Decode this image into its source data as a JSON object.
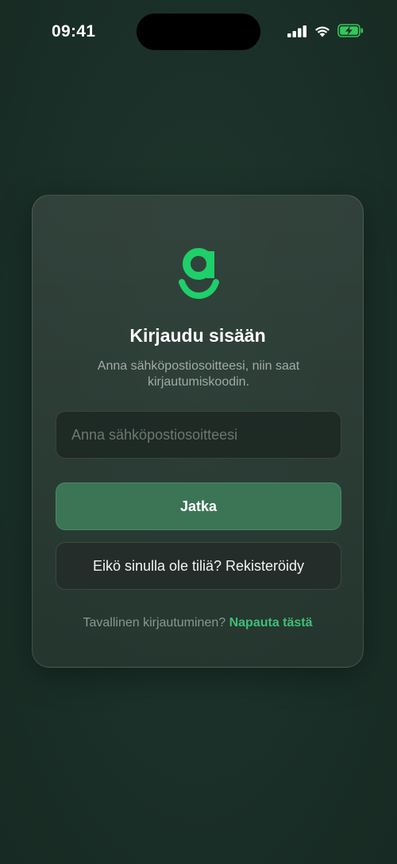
{
  "status_bar": {
    "time": "09:41",
    "icons": [
      "cellular-signal-icon",
      "wifi-icon",
      "battery-charging-icon"
    ],
    "battery_color": "#34c759"
  },
  "brand": {
    "logo_icon": "g-logo-icon",
    "accent_color": "#1ecf6a"
  },
  "login": {
    "title": "Kirjaudu sisään",
    "subtitle": "Anna sähköpostiosoitteesi, niin saat kirjautumiskoodin.",
    "email_value": "",
    "email_placeholder": "Anna sähköpostiosoitteesi",
    "continue_label": "Jatka",
    "register_label": "Eikö sinulla ole tiliä? Rekisteröidy",
    "classic_login_text": "Tavallinen kirjautuminen?",
    "classic_login_link": "Napauta tästä"
  }
}
